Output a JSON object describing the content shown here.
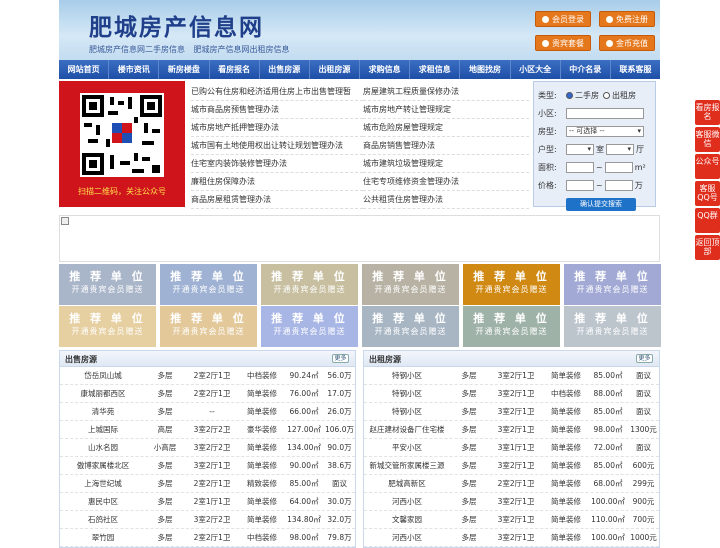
{
  "header": {
    "title": "肥城房产信息网",
    "subtitle": "肥城房产信息网二手房信息    肥城房产信息网出租房信息",
    "buttons": [
      "会员登录",
      "免费注册",
      "贵宾套餐",
      "金币充值"
    ]
  },
  "nav": [
    "网站首页",
    "楼市资讯",
    "新房楼盘",
    "看房报名",
    "出售房源",
    "出租房源",
    "求购信息",
    "求租信息",
    "地图找房",
    "小区大全",
    "中介名录",
    "联系客服"
  ],
  "qr": {
    "caption": "扫描二维码，关注公众号"
  },
  "links": [
    "已购公有住房和经济适用住房上市出售管理暂",
    "房屋建筑工程质量保修办法",
    "城市商品房预售管理办法",
    "城市房地产转让管理规定",
    "城市房地产抵押管理办法",
    "城市危险房屋管理规定",
    "城市国有土地使用权出让转让规划管理办法",
    "商品房销售管理办法",
    "住宅室内装饰装修管理办法",
    "城市建筑垃圾管理规定",
    "廉租住房保障办法",
    "住宅专项维修资金管理办法",
    "商品房屋租赁管理办法",
    "公共租赁住房管理办法"
  ],
  "search": {
    "type_label": "类型:",
    "type_options": [
      "二手房",
      "出租房"
    ],
    "community_label": "小区:",
    "housetype_label": "房型:",
    "housetype_value": "-- 可选择 --",
    "layout_label": "户型:",
    "room_unit": "室",
    "hall_unit": "厅",
    "area_label": "面积:",
    "area_unit": "m²",
    "price_label": "价格:",
    "price_unit": "万",
    "range_sep": "~",
    "submit": "确认提交搜索"
  },
  "ads": {
    "line1": "推 荐 单 位",
    "line2": "开通贵宾会员赠送",
    "colors": [
      "#a9b5c8",
      "#9fb2d3",
      "#c7bfa0",
      "#b8b2a4",
      "#d08a14",
      "#a2a9d4",
      "#e6cfa0",
      "#e3c89a",
      "#a8b6e6",
      "#a8b6c4",
      "#9fb2a8",
      "#bcc4cc"
    ]
  },
  "sale": {
    "title": "出售房源",
    "more": "更多",
    "rows": [
      [
        "岱岳凤山城",
        "多层",
        "2室2厅1卫",
        "中档装修",
        "90.24㎡",
        "56.0万"
      ],
      [
        "康城丽都西区",
        "多层",
        "2室2厅1卫",
        "简单装修",
        "76.00㎡",
        "17.0万"
      ],
      [
        "清华苑",
        "多层",
        "--",
        "简单装修",
        "66.00㎡",
        "26.0万"
      ],
      [
        "上城国际",
        "高层",
        "3室2厅2卫",
        "豪华装修",
        "127.00㎡",
        "106.0万"
      ],
      [
        "山水名园",
        "小高层",
        "3室2厅2卫",
        "简单装修",
        "134.00㎡",
        "90.0万"
      ],
      [
        "傲博家属楼北区",
        "多层",
        "3室2厅1卫",
        "简单装修",
        "90.00㎡",
        "38.6万"
      ],
      [
        "上海世纪城",
        "多层",
        "2室2厅1卫",
        "精致装修",
        "85.00㎡",
        "面议"
      ],
      [
        "惠民中区",
        "多层",
        "2室1厅1卫",
        "简单装修",
        "64.00㎡",
        "30.0万"
      ],
      [
        "石鸽社区",
        "多层",
        "3室2厅2卫",
        "简单装修",
        "134.80㎡",
        "32.0万"
      ],
      [
        "翠竹园",
        "多层",
        "2室2厅1卫",
        "中档装修",
        "98.00㎡",
        "79.8万"
      ]
    ]
  },
  "rent": {
    "title": "出租房源",
    "more": "更多",
    "rows": [
      [
        "特钢小区",
        "多层",
        "3室2厅1卫",
        "简单装修",
        "85.00㎡",
        "面议"
      ],
      [
        "特钢小区",
        "多层",
        "3室2厅1卫",
        "中档装修",
        "88.00㎡",
        "面议"
      ],
      [
        "特钢小区",
        "多层",
        "3室2厅1卫",
        "简单装修",
        "85.00㎡",
        "面议"
      ],
      [
        "赵庄建材设备厂住宅楼",
        "多层",
        "3室2厅1卫",
        "简单装修",
        "98.00㎡",
        "1300元"
      ],
      [
        "平安小区",
        "多层",
        "3室1厅1卫",
        "简单装修",
        "72.00㎡",
        "面议"
      ],
      [
        "新城交管所家属楼三源",
        "多层",
        "3室2厅1卫",
        "简单装修",
        "85.00㎡",
        "600元"
      ],
      [
        "肥城高新区",
        "多层",
        "2室2厅1卫",
        "简单装修",
        "68.00㎡",
        "299元"
      ],
      [
        "河西小区",
        "多层",
        "3室2厅1卫",
        "简单装修",
        "100.00㎡",
        "900元"
      ],
      [
        "文馨家园",
        "多层",
        "3室2厅1卫",
        "简单装修",
        "110.00㎡",
        "700元"
      ],
      [
        "河西小区",
        "多层",
        "3室2厅1卫",
        "简单装修",
        "100.00㎡",
        "1000元"
      ]
    ]
  },
  "side": [
    "看房报名",
    "客服微信",
    "公众号",
    "客服QQ号",
    "QQ群",
    "返回顶部"
  ]
}
